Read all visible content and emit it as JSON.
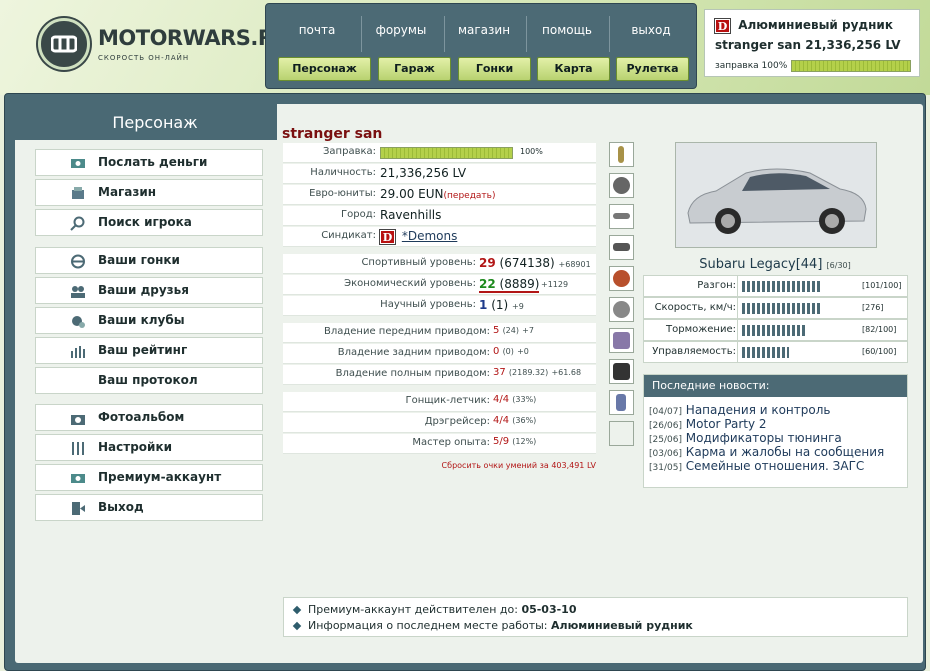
{
  "logo": {
    "name": "MOTORWARS.RU",
    "tagline": "СКОРОСТЬ ОН-ЛАЙН"
  },
  "topnav": [
    "почта",
    "форумы",
    "магазин",
    "помощь",
    "выход"
  ],
  "greennav": [
    "Персонаж",
    "Гараж",
    "Гонки",
    "Карта",
    "Рулетка"
  ],
  "status": {
    "location": "Алюминиевый рудник",
    "player_line": "stranger san 21,336,256 LV",
    "fuel_label": "заправка 100%",
    "fuel_fraction": 1.0
  },
  "sidebar": {
    "title": "Персонаж",
    "items": [
      {
        "label": "Послать деньги",
        "icon": "money-icon"
      },
      {
        "label": "Магазин",
        "icon": "shop-icon"
      },
      {
        "label": "Поиск игрока",
        "icon": "search-icon"
      },
      {
        "label": "Ваши гонки",
        "icon": "steering-wheel-icon"
      },
      {
        "label": "Ваши друзья",
        "icon": "friends-icon"
      },
      {
        "label": "Ваши клубы",
        "icon": "clubs-icon"
      },
      {
        "label": "Ваш рейтинг",
        "icon": "rating-icon"
      },
      {
        "label": "Ваш протокол",
        "icon": ""
      },
      {
        "label": "Фотоальбом",
        "icon": "camera-icon"
      },
      {
        "label": "Настройки",
        "icon": "settings-icon"
      },
      {
        "label": "Премиум-аккаунт",
        "icon": "premium-icon"
      },
      {
        "label": "Выход",
        "icon": "exit-icon"
      }
    ]
  },
  "player": {
    "name": "stranger san",
    "fuel_label": "Заправка:",
    "fuel_pct": "100%",
    "fuel_fraction": 1.0,
    "cash_label": "Наличность:",
    "cash": "21,336,256 LV",
    "eun_label": "Евро-юниты:",
    "eun": "29.00 EUN",
    "eun_action": "(передать)",
    "city_label": "Город:",
    "city": "Ravenhills",
    "syndicate_label": "Синдикат:",
    "syndicate": "*Demons",
    "sport_label": "Спортивный уровень:",
    "sport_level": "29",
    "sport_points": "(674138)",
    "sport_next": "+68901",
    "econ_label": "Экономический уровень:",
    "econ_level": "22",
    "econ_points": "(8889)",
    "econ_next": "+1129",
    "sci_label": "Научный уровень:",
    "sci_level": "1",
    "sci_points": "(1)",
    "sci_next": "+9",
    "fwd_label": "Владение передним приводом:",
    "fwd_level": "5",
    "fwd_points": "(24)",
    "fwd_next": "+7",
    "rwd_label": "Владение задним приводом:",
    "rwd_level": "0",
    "rwd_points": "(0)",
    "rwd_next": "+0",
    "awd_label": "Владение полным приводом:",
    "awd_level": "37",
    "awd_points": "(2189.32)",
    "awd_next": "+61.68",
    "pilot_label": "Гонщик-летчик:",
    "pilot_val": "4/4",
    "pilot_pct": "(33%)",
    "drag_label": "Дрэгрейсер:",
    "drag_val": "4/4",
    "drag_pct": "(36%)",
    "master_label": "Мастер опыта:",
    "master_val": "5/9",
    "master_pct": "(12%)",
    "reset": "Сбросить очки умений за 403,491 LV"
  },
  "car": {
    "name": "Subaru Legacy[44]",
    "slot": "[6/30]",
    "stats": [
      {
        "label": "Разгон:",
        "value": "[101/100]",
        "fraction": 1.0
      },
      {
        "label": "Скорость, км/ч:",
        "value": "[276]",
        "fraction": 1.0
      },
      {
        "label": "Торможение:",
        "value": "[82/100]",
        "fraction": 0.82
      },
      {
        "label": "Управляемость:",
        "value": "[60/100]",
        "fraction": 0.6
      }
    ]
  },
  "news": {
    "title": "Последние новости:",
    "items": [
      {
        "date": "[04/07]",
        "text": "Нападения и контроль"
      },
      {
        "date": "[26/06]",
        "text": "Motor Party 2"
      },
      {
        "date": "[25/06]",
        "text": "Модификаторы тюнинга"
      },
      {
        "date": "[03/06]",
        "text": "Карма и жалобы на сообщения"
      },
      {
        "date": "[31/05]",
        "text": "Семейные отношения. ЗАГС"
      }
    ]
  },
  "info": {
    "premium_label": "Премиум-аккаунт действителен до:",
    "premium_date": "05-03-10",
    "work_label": "Информация о последнем месте работы:",
    "work_place": "Алюминиевый рудник"
  },
  "colors": {
    "accent": "#4a6974",
    "green_btn": "#c8de88",
    "fuel": "#a8c640",
    "red": "#b21616"
  }
}
